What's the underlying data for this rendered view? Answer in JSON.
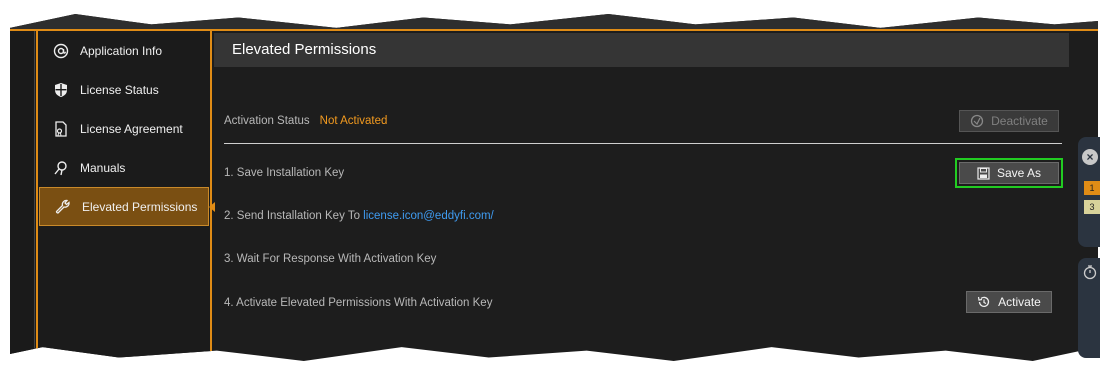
{
  "sidebar": {
    "items": [
      {
        "label": "Application Info",
        "icon": "at-icon"
      },
      {
        "label": "License Status",
        "icon": "shield-icon"
      },
      {
        "label": "License Agreement",
        "icon": "document-icon"
      },
      {
        "label": "Manuals",
        "icon": "manual-icon"
      },
      {
        "label": "Elevated Permissions",
        "icon": "wrench-icon",
        "active": true
      }
    ]
  },
  "header": {
    "title": "Elevated Permissions"
  },
  "activation": {
    "label": "Activation Status",
    "value": "Not Activated",
    "deactivate_label": "Deactivate"
  },
  "steps": [
    {
      "text": "1. Save Installation Key",
      "button": "Save As"
    },
    {
      "text": "2. Send Installation Key To",
      "link": "license.icon@eddyfi.com/"
    },
    {
      "text": "3. Wait For Response With Activation Key"
    },
    {
      "text": "4. Activate Elevated Permissions With Activation Key",
      "button": "Activate"
    }
  ],
  "side_panel": {
    "badges": [
      "1",
      "3"
    ]
  },
  "colors": {
    "accent": "#e08c16",
    "status": "#f29a1f",
    "link": "#3f9bf0",
    "focus": "#22cc22"
  }
}
